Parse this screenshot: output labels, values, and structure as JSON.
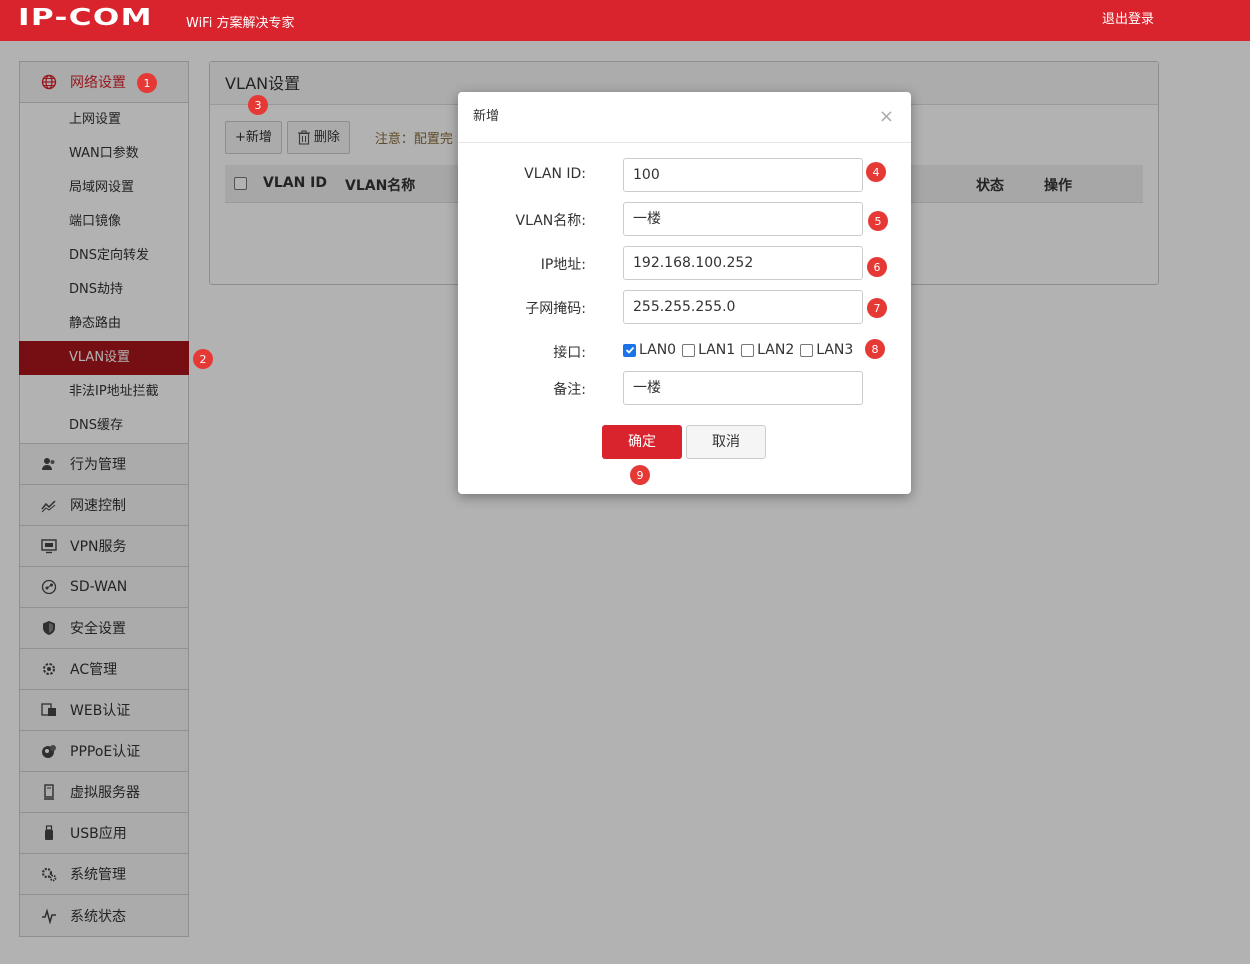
{
  "header": {
    "logo": "IP-COM",
    "tagline": "WiFi 方案解决专家",
    "logout": "退出登录",
    "brand_color": "#d9232d"
  },
  "sidebar": {
    "network": {
      "label": "网络设置",
      "icon": "globe-icon",
      "items": [
        {
          "label": "上网设置"
        },
        {
          "label": "WAN口参数"
        },
        {
          "label": "局域网设置"
        },
        {
          "label": "端口镜像"
        },
        {
          "label": "DNS定向转发"
        },
        {
          "label": "DNS劫持"
        },
        {
          "label": "静态路由"
        },
        {
          "label": "VLAN设置"
        },
        {
          "label": "非法IP地址拦截"
        },
        {
          "label": "DNS缓存"
        }
      ]
    },
    "groups": [
      {
        "label": "行为管理",
        "icon": "users-icon"
      },
      {
        "label": "网速控制",
        "icon": "speed-chart-icon"
      },
      {
        "label": "VPN服务",
        "icon": "monitor-icon"
      },
      {
        "label": "SD-WAN",
        "icon": "sdwan-icon"
      },
      {
        "label": "安全设置",
        "icon": "shield-icon"
      },
      {
        "label": "AC管理",
        "icon": "gear-network-icon"
      },
      {
        "label": "WEB认证",
        "icon": "web-auth-icon"
      },
      {
        "label": "PPPoE认证",
        "icon": "pppoe-icon"
      },
      {
        "label": "虚拟服务器",
        "icon": "server-icon"
      },
      {
        "label": "USB应用",
        "icon": "usb-icon"
      },
      {
        "label": "系统管理",
        "icon": "gears-icon"
      },
      {
        "label": "系统状态",
        "icon": "pulse-icon"
      }
    ]
  },
  "main": {
    "title": "VLAN设置",
    "add_label": "+新增",
    "delete_label": "删除",
    "notice": "注意：配置完",
    "columns": [
      "VLAN ID",
      "VLAN名称",
      "状态",
      "操作"
    ]
  },
  "modal": {
    "title": "新增",
    "close": "×",
    "fields": {
      "vlan_id": {
        "label": "VLAN ID:",
        "value": "100"
      },
      "vlan_name": {
        "label": "VLAN名称:",
        "value": "一楼"
      },
      "ip": {
        "label": "IP地址:",
        "value": "192.168.100.252"
      },
      "mask": {
        "label": "子网掩码:",
        "value": "255.255.255.0"
      },
      "ports": {
        "label": "接口:"
      },
      "remark": {
        "label": "备注:",
        "value": "一楼"
      }
    },
    "ports": [
      {
        "label": "LAN0",
        "checked": true
      },
      {
        "label": "LAN1",
        "checked": false
      },
      {
        "label": "LAN2",
        "checked": false
      },
      {
        "label": "LAN3",
        "checked": false
      }
    ],
    "ok_label": "确定",
    "cancel_label": "取消"
  },
  "badges": [
    "1",
    "2",
    "3",
    "4",
    "5",
    "6",
    "7",
    "8",
    "9"
  ]
}
